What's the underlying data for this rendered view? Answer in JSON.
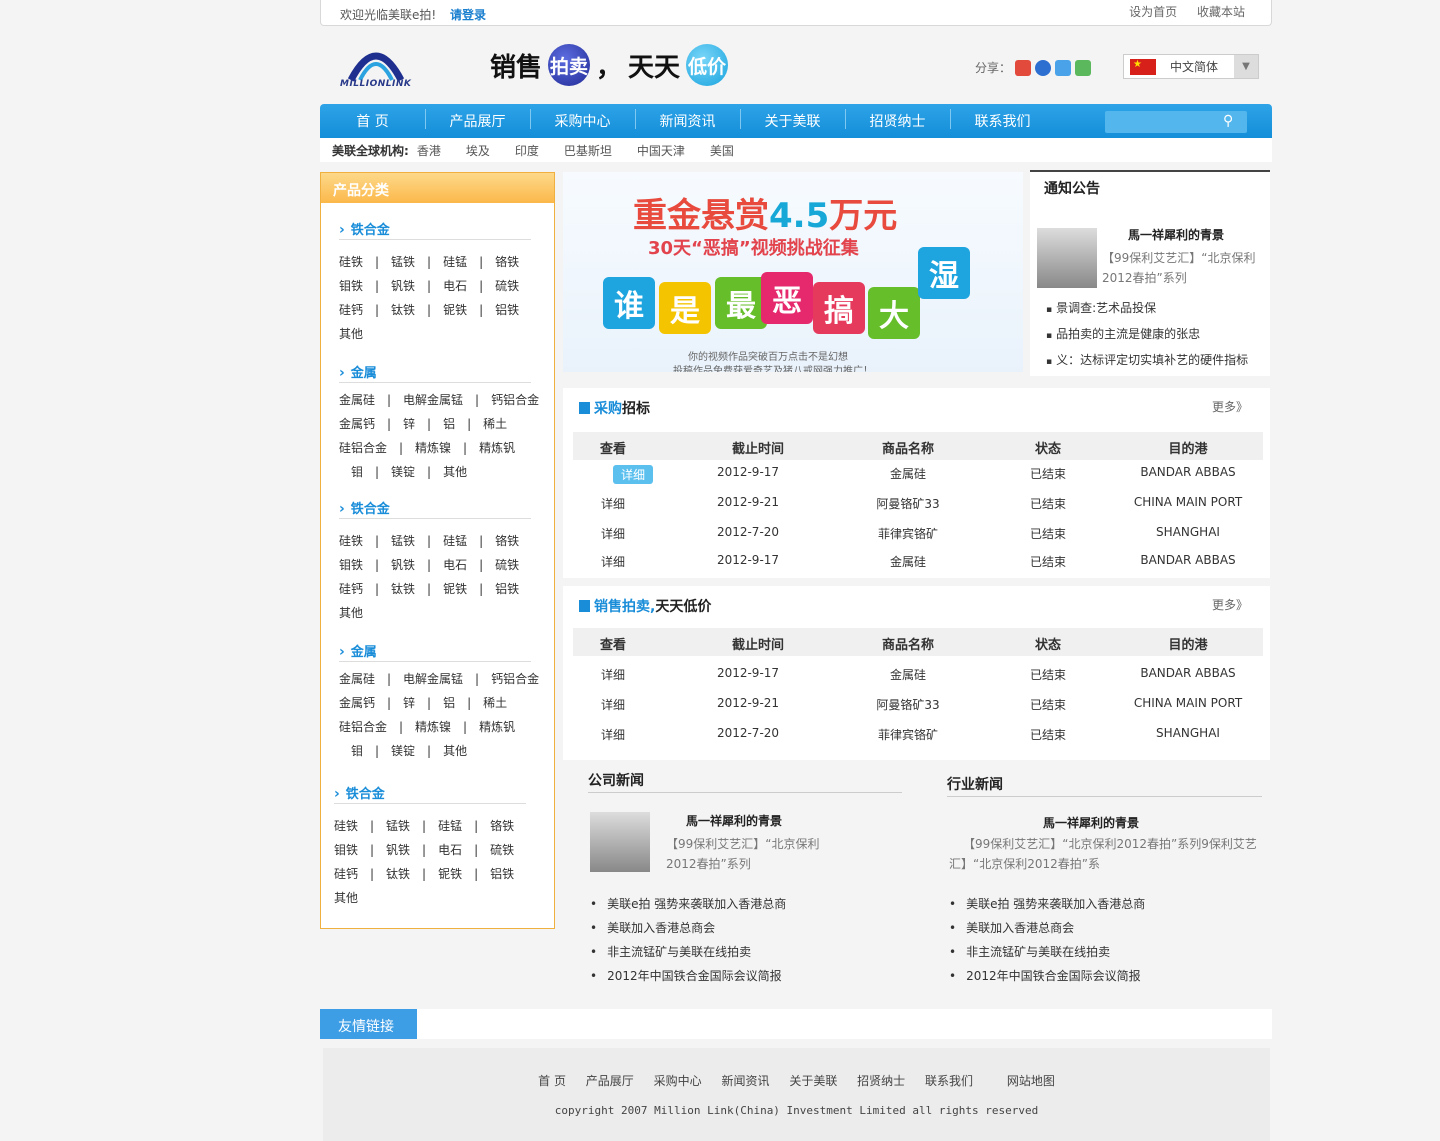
{
  "topbar": {
    "welcome": "欢迎光临美联e拍!",
    "login": "请登录",
    "set_home": "设为首页",
    "bookmark": "收藏本站"
  },
  "header": {
    "logo_text": "MILLIONLINK",
    "slogan_a": "销售",
    "slogan_circle1": "拍卖",
    "slogan_comma": "，",
    "slogan_b": "天天",
    "slogan_circle2": "低价",
    "share_label": "分享：",
    "lang": "中文简体"
  },
  "nav": {
    "items": [
      "首 页",
      "产品展厅",
      "采购中心",
      "新闻资讯",
      "关于美联",
      "招贤纳士",
      "联系我们"
    ]
  },
  "global": {
    "label": "美联全球机构:",
    "places": [
      "香港",
      "埃及",
      "印度",
      "巴基斯坦",
      "中国天津",
      "美国"
    ]
  },
  "sidebar": {
    "title": "产品分类",
    "cats": [
      {
        "name": "铁合金",
        "rows": [
          "硅铁　|　锰铁　|　硅锰　|　铬铁",
          "钼铁　|　钒铁　|　电石　|　硫铁",
          "硅钙　|　钛铁　|　铌铁　|　铝铁",
          "其他"
        ]
      },
      {
        "name": "金属",
        "rows": [
          "金属硅　|　电解金属锰　|　钙铝合金",
          "金属钙　|　锌　|　铝　|　稀土",
          "硅铝合金　|　精炼镍　|　精炼钒",
          "　钼　|　镁锭　|　其他"
        ]
      },
      {
        "name": "铁合金",
        "rows": [
          "硅铁　|　锰铁　|　硅锰　|　铬铁",
          "钼铁　|　钒铁　|　电石　|　硫铁",
          "硅钙　|　钛铁　|　铌铁　|　铝铁",
          "其他"
        ]
      },
      {
        "name": "金属",
        "rows": [
          "金属硅　|　电解金属锰　|　钙铝合金",
          "金属钙　|　锌　|　铝　|　稀土",
          "硅铝合金　|　精炼镍　|　精炼钒",
          "　钼　|　镁锭　|　其他"
        ]
      },
      {
        "name": "铁合金",
        "rows": [
          "硅铁　|　锰铁　|　硅锰　|　铬铁",
          "钼铁　|　钒铁　|　电石　|　硫铁",
          "硅钙　|　钛铁　|　铌铁　|　铝铁",
          "其他"
        ]
      }
    ]
  },
  "banner": {
    "line1_a": "重金悬赏",
    "line1_num": "4.5",
    "line1_b": "万元",
    "line2": "30天“恶搞”视频挑战征集",
    "blocks": [
      "谁",
      "是",
      "最",
      "恶",
      "搞",
      "大",
      "湿"
    ],
    "small1": "你的视频作品突破百万点击不是幻想",
    "small2": "投稿作品免费获爱奇艺及猪八戒网强力推广！"
  },
  "notice": {
    "title": "通知公告",
    "headline": "馬一祥犀利的青景",
    "desc": "【99保利艾艺汇】“北京保利2012春拍”系列",
    "items": [
      "景调查:艺术品投保",
      "品拍卖的主流是健康的张忠",
      "义：达标评定切实填补艺的硬件指标"
    ]
  },
  "purchase": {
    "title_hl": "采购",
    "title_rest": "招标",
    "more": "更多》",
    "headers": [
      "查看",
      "截止时间",
      "商品名称",
      "状态",
      "目的港"
    ],
    "rows": [
      [
        "详细",
        "2012-9-17",
        "金属硅",
        "已结束",
        "BANDAR ABBAS"
      ],
      [
        "详细",
        "2012-9-21",
        "阿曼铬矿33",
        "已结束",
        "CHINA MAIN PORT"
      ],
      [
        "详细",
        "2012-7-20",
        "菲律宾铬矿",
        "已结束",
        "SHANGHAI"
      ],
      [
        "详细",
        "2012-9-17",
        "金属硅",
        "已结束",
        "BANDAR ABBAS"
      ]
    ]
  },
  "auction": {
    "title_hl": "销售拍卖,",
    "title_rest": "天天低价",
    "more": "更多》",
    "headers": [
      "查看",
      "截止时间",
      "商品名称",
      "状态",
      "目的港"
    ],
    "rows": [
      [
        "详细",
        "2012-9-17",
        "金属硅",
        "已结束",
        "BANDAR ABBAS"
      ],
      [
        "详细",
        "2012-9-21",
        "阿曼铬矿33",
        "已结束",
        "CHINA MAIN PORT"
      ],
      [
        "详细",
        "2012-7-20",
        "菲律宾铬矿",
        "已结束",
        "SHANGHAI"
      ]
    ]
  },
  "company_news": {
    "title": "公司新闻",
    "headline": "馬一祥犀利的青景",
    "desc": "【99保利艾艺汇】“北京保利2012春拍”系列",
    "items": [
      "美联e拍 强势来袭联加入香港总商",
      "美联加入香港总商会",
      "非主流锰矿与美联在线拍卖",
      "2012年中国铁合金国际会议简报"
    ]
  },
  "industry_news": {
    "title": "行业新闻",
    "headline": "馬一祥犀利的青景",
    "desc": "【99保利艾艺汇】“北京保利2012春拍”系列9保利艾艺汇】“北京保利2012春拍”系",
    "items": [
      "美联e拍 强势来袭联加入香港总商",
      "美联加入香港总商会",
      "非主流锰矿与美联在线拍卖",
      "2012年中国铁合金国际会议简报"
    ]
  },
  "friend": {
    "title": "友情链接"
  },
  "footer": {
    "links": [
      "首 页",
      "产品展厅",
      "采购中心",
      "新闻资讯",
      "关于美联",
      "招贤纳士",
      "联系我们",
      "网站地图"
    ],
    "copyright": "copyright 2007 Million Link(China) Investment Limited all rights reserved"
  }
}
